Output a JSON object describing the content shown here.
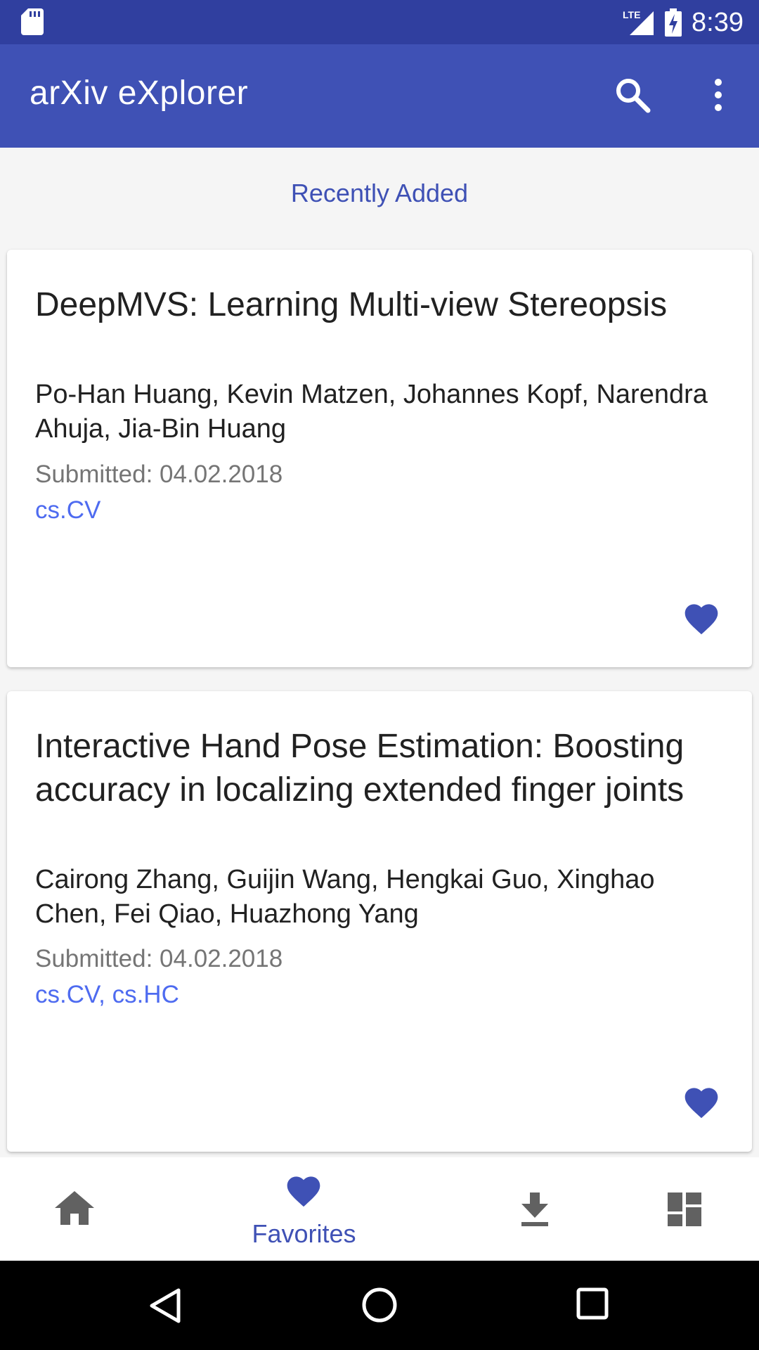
{
  "status_bar": {
    "time": "8:39",
    "network": "LTE",
    "icons": [
      "sd-card-icon",
      "signal-icon",
      "battery-charging-icon"
    ]
  },
  "app_bar": {
    "title": "arXiv eXplorer",
    "icons": [
      "search-icon",
      "more-vert-icon"
    ]
  },
  "section": {
    "title": "Recently Added"
  },
  "papers": [
    {
      "title": "DeepMVS: Learning Multi-view Stereopsis",
      "authors": "Po-Han Huang, Kevin Matzen, Johannes Kopf, Narendra Ahuja, Jia-Bin Huang",
      "submitted": "Submitted: 04.02.2018",
      "categories": "cs.CV",
      "favorite": true
    },
    {
      "title": "Interactive Hand Pose Estimation: Boosting accuracy in localizing extended finger joints",
      "authors": "Cairong Zhang, Guijin Wang, Hengkai Guo, Xinghao Chen, Fei Qiao, Huazhong Yang",
      "submitted": "Submitted: 04.02.2018",
      "categories": "cs.CV, cs.HC",
      "favorite": true
    }
  ],
  "bottom_nav": {
    "items": [
      {
        "icon": "home-icon",
        "label": ""
      },
      {
        "icon": "heart-icon",
        "label": "Favorites",
        "selected": true
      },
      {
        "icon": "download-icon",
        "label": ""
      },
      {
        "icon": "dashboard-icon",
        "label": ""
      }
    ]
  },
  "system_nav": {
    "icons": [
      "back-icon",
      "home-circle-icon",
      "recents-icon"
    ]
  },
  "colors": {
    "status_bar": "#303f9f",
    "primary": "#3f51b5",
    "category_link": "#4e6bf0",
    "inactive_icon": "#616161"
  }
}
